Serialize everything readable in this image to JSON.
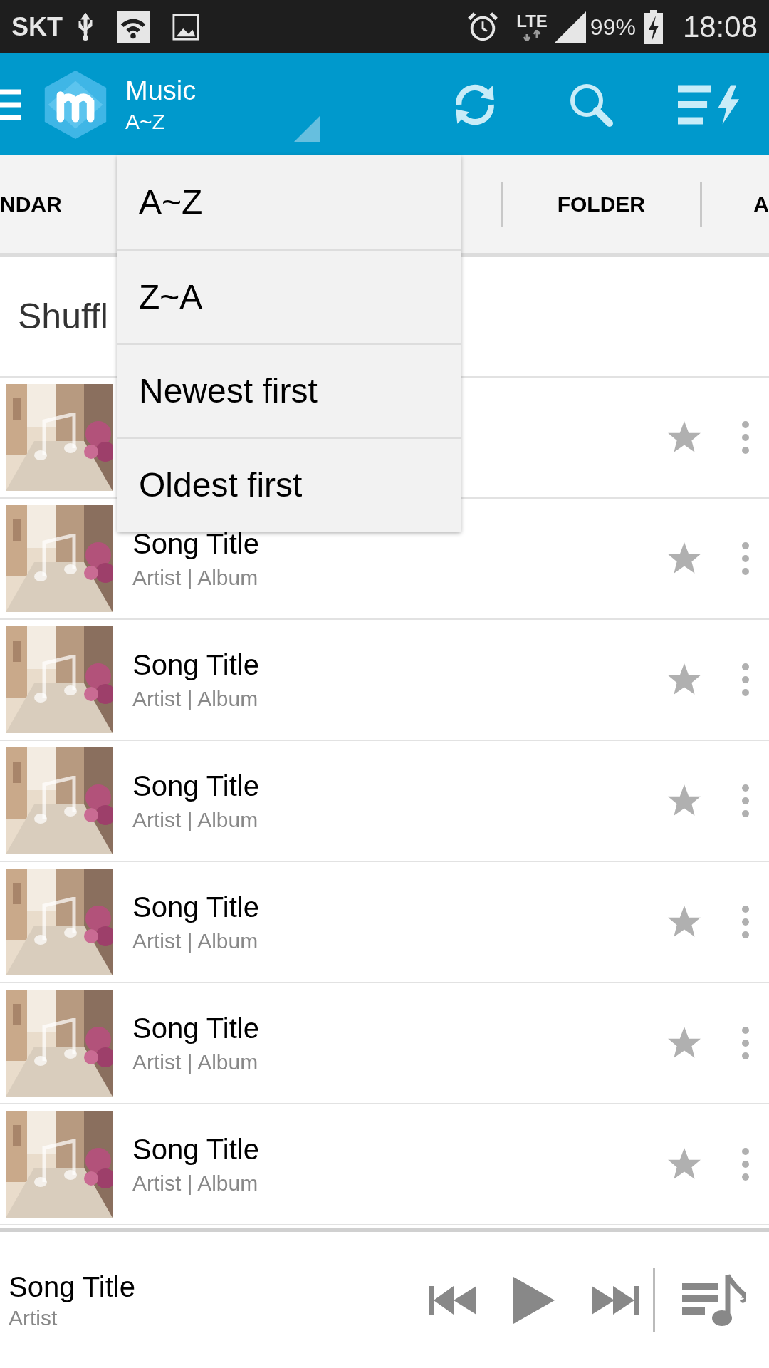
{
  "status_bar": {
    "carrier": "SKT",
    "network": "LTE",
    "battery": "99%",
    "time": "18:08"
  },
  "app_bar": {
    "title": "Music",
    "subtitle": "A~Z"
  },
  "tabs": [
    {
      "label": "NDAR"
    },
    {
      "label": "FOLDER"
    },
    {
      "label": "A"
    }
  ],
  "shuffle": {
    "label": "Shuffl"
  },
  "songs": [
    {
      "starred": false
    },
    {
      "title": "Song Title",
      "subtitle": "Artist | Album",
      "starred": false
    },
    {
      "title": "Song Title",
      "subtitle": "Artist | Album",
      "starred": false
    },
    {
      "title": "Song Title",
      "subtitle": "Artist | Album",
      "starred": false
    },
    {
      "title": "Song Title",
      "subtitle": "Artist | Album",
      "starred": false
    },
    {
      "title": "Song Title",
      "subtitle": "Artist | Album",
      "starred": false
    },
    {
      "title": "Song Title",
      "subtitle": "Artist | Album",
      "starred": false
    }
  ],
  "sort_menu": {
    "items": [
      {
        "label": "A~Z"
      },
      {
        "label": "Z~A"
      },
      {
        "label": "Newest first"
      },
      {
        "label": "Oldest first"
      }
    ]
  },
  "now_playing": {
    "title": "Song Title",
    "artist": "Artist"
  }
}
